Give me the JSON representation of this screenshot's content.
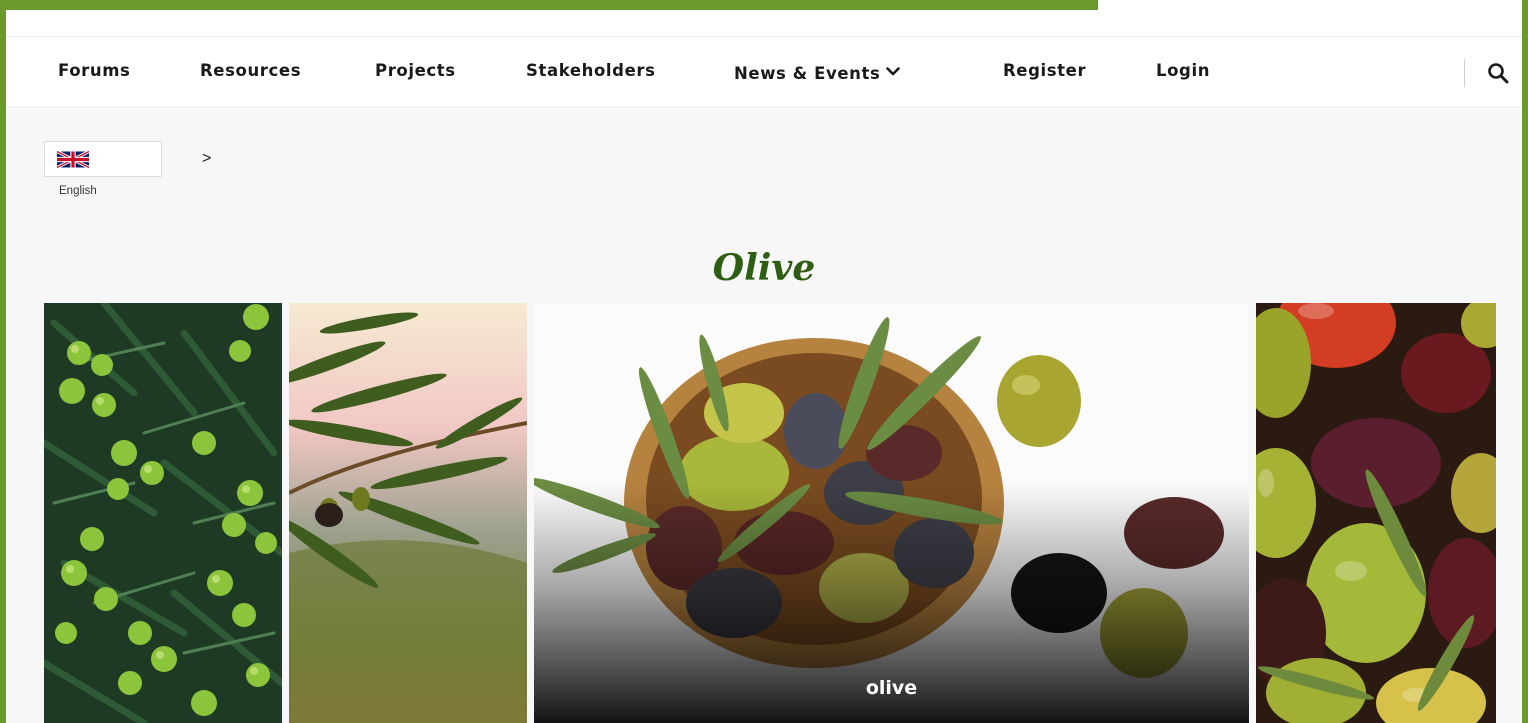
{
  "nav": {
    "items": [
      {
        "label": "Forums"
      },
      {
        "label": "Resources"
      },
      {
        "label": "Projects"
      },
      {
        "label": "Stakeholders"
      },
      {
        "label": "News & Events",
        "icon": "chevron-down-icon"
      },
      {
        "label": "Register"
      },
      {
        "label": "Login"
      }
    ],
    "search_icon": "search-icon"
  },
  "language": {
    "flag_icon": "uk-flag-icon",
    "label": "English",
    "arrow": ">"
  },
  "page": {
    "title": "Olive"
  },
  "gallery": {
    "items": [
      {
        "image": "olive-tree-branch-photo"
      },
      {
        "image": "olive-sprig-sunset-photo"
      },
      {
        "image": "olive-bowl-photo",
        "caption": "olive"
      },
      {
        "image": "mixed-olives-photo"
      }
    ]
  },
  "colors": {
    "brand_green": "#6a9a2c",
    "title_green": "#2f5d14",
    "nav_text": "#1a1a1a",
    "content_bg": "#f7f7f8"
  }
}
